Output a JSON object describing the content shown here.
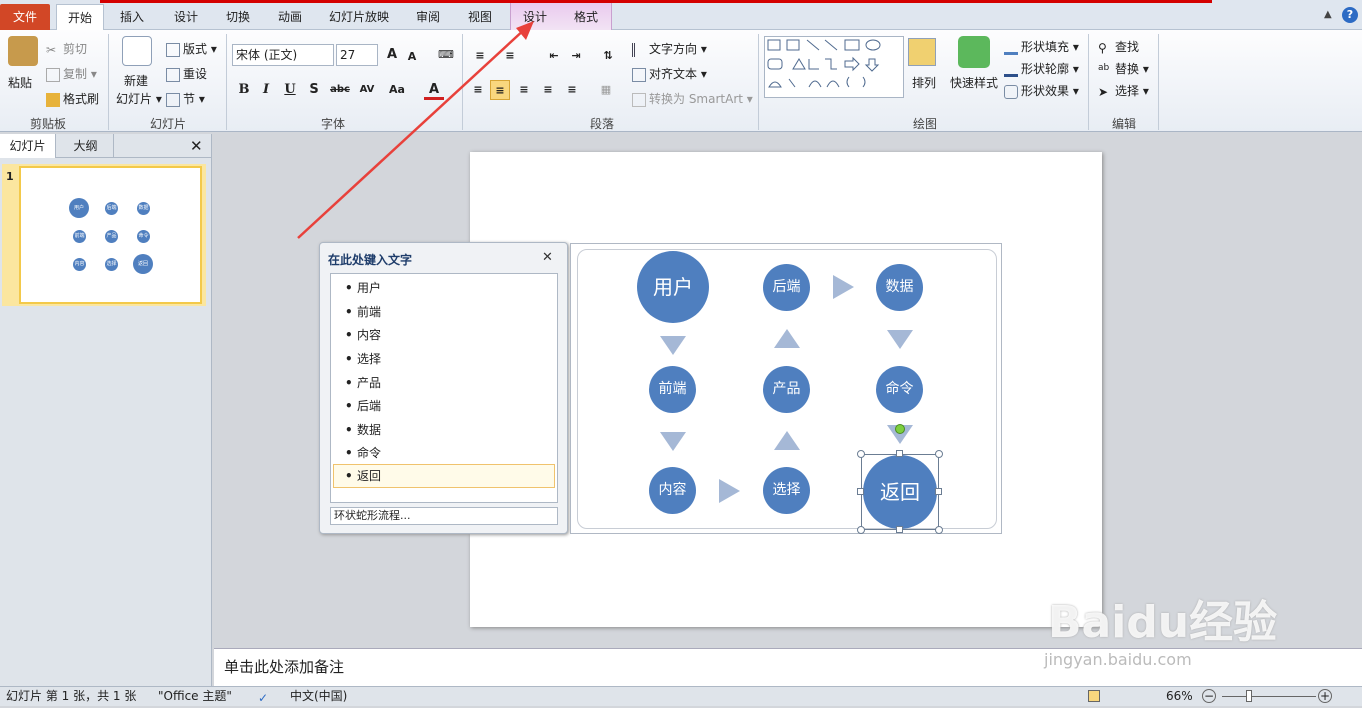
{
  "ribbon_tabs": {
    "file": "文件",
    "home": "开始",
    "insert": "插入",
    "design": "设计",
    "transitions": "切换",
    "animations": "动画",
    "slideshow": "幻灯片放映",
    "review": "审阅",
    "view": "视图",
    "smartart_design": "设计",
    "smartart_format": "格式"
  },
  "clipboard": {
    "paste": "粘贴",
    "cut": "剪切",
    "copy": "复制",
    "format_painter": "格式刷",
    "label": "剪贴板"
  },
  "slides_group": {
    "new_slide": "新建",
    "new_slide2": "幻灯片",
    "layout": "版式",
    "reset": "重设",
    "section": "节",
    "label": "幻灯片"
  },
  "font_group": {
    "font_name": "宋体 (正文)",
    "font_size": "27",
    "label": "字体"
  },
  "paragraph_group": {
    "text_direction": "文字方向",
    "align_text": "对齐文本",
    "convert_smartart": "转换为 SmartArt",
    "label": "段落"
  },
  "drawing_group": {
    "arrange": "排列",
    "quick_styles": "快速样式",
    "shape_fill": "形状填充",
    "shape_outline": "形状轮廓",
    "shape_effects": "形状效果",
    "label": "绘图"
  },
  "editing_group": {
    "find": "查找",
    "replace": "替换",
    "select": "选择",
    "label": "编辑"
  },
  "left_pane": {
    "tab_slides": "幻灯片",
    "tab_outline": "大纲",
    "slide_number": "1"
  },
  "thumbnail_labels": [
    "用户",
    "后端",
    "数据",
    "前端",
    "产品",
    "命令",
    "内容",
    "选择",
    "返回"
  ],
  "text_pane": {
    "title": "在此处键入文字",
    "items": [
      "用户",
      "前端",
      "内容",
      "选择",
      "产品",
      "后端",
      "数据",
      "命令",
      "返回"
    ],
    "footer": "环状蛇形流程..."
  },
  "smartart_nodes": {
    "user": "用户",
    "backend": "后端",
    "data": "数据",
    "frontend": "前端",
    "product": "产品",
    "command": "命令",
    "content": "内容",
    "select": "选择",
    "return": "返回"
  },
  "notes_placeholder": "单击此处添加备注",
  "status": {
    "slide_info": "幻灯片 第 1 张，共 1 张",
    "theme": "\"Office 主题\"",
    "language": "中文(中国)",
    "zoom": "66%"
  },
  "colors": {
    "node": "#4f7fbf",
    "arrow": "#a5b8d6",
    "file_tab": "#d24726",
    "accent_line": "#d40000"
  },
  "annotation": {
    "watermark": "Baidu经验",
    "watermark_url": "jingyan.baidu.com"
  }
}
